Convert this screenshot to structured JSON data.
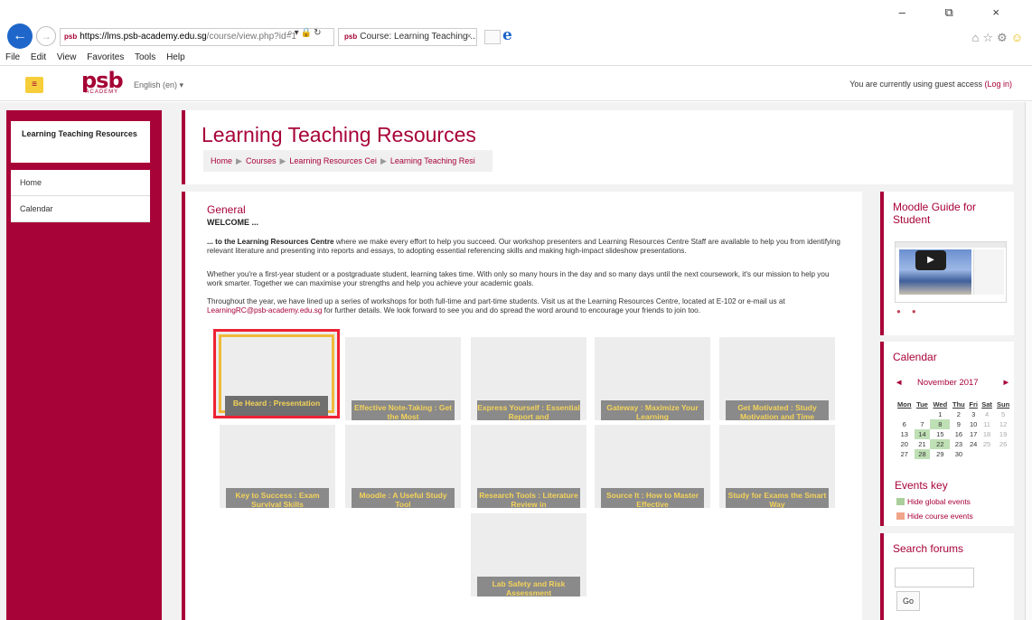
{
  "browser": {
    "url_host": "https://lms.psb-academy.edu.sg",
    "url_path": "/course/view.php?id=1",
    "tab_label": "Course: Learning Teaching ...",
    "menu": [
      "File",
      "Edit",
      "View",
      "Favorites",
      "Tools",
      "Help"
    ],
    "window_controls": "– ⧉ ×",
    "toolbar_icons": [
      "home-icon",
      "star-icon",
      "gear-icon",
      "smiley-icon"
    ]
  },
  "header": {
    "logo": "psb",
    "logo_sub": "ACADEMY",
    "language": "English (en) ▾",
    "guest_text": "You are currently using guest access",
    "login_link": "(Log in)"
  },
  "sidebar": {
    "block_title": "Learning Teaching Resources",
    "nav": [
      "Home",
      "Calendar"
    ]
  },
  "title_panel": {
    "title": "Learning Teaching Resources",
    "breadcrumb": [
      "Home",
      "Courses",
      "Learning Resources Cei",
      "Learning Teaching Resi"
    ]
  },
  "content": {
    "section": "General",
    "welcome": "WELCOME ...",
    "p1_bold": "... to the Learning Resources Centre",
    "p1_text": " where we make every effort to help you succeed. Our workshop presenters and Learning Resources Centre Staff are available to help you from identifying relevant literature and presenting into reports and essays, to adopting essential referencing skills and making high-impact slideshow presentations.",
    "p2": "Whether you're a first-year student or a postgraduate student, learning takes time. With only so many hours in the day and so many days until the next coursework, it's our mission to help you work smarter. Together we can maximise your strengths and help you achieve your academic goals.",
    "p3_a": "Throughout the year, we have lined up a series of workshops for both full-time and part-time students. Visit us at the Learning Resources Centre, located at E-102 or e-mail us at ",
    "p3_email": "LearningRC@psb-academy.edu.sg",
    "p3_b": "  for further details.  We look forward to see you and do spread the word around to encourage your friends to join too.",
    "tiles": [
      "Be Heard : Presentation",
      "Effective Note-Taking : Get the Most",
      "Express Yourself : Essential Report and",
      "Gateway : Maximize Your Learning",
      "Get Motivated : Study Motivation and Time",
      "Key to Success : Exam Survival Skills",
      "Moodle : A Useful Study Tool",
      "Research Tools : Literature Review in",
      "Source It : How to Master Effective",
      "Study for Exams the Smart Way",
      "Lab Safety and Risk Assessment"
    ]
  },
  "moodle_guide": {
    "title": "Moodle Guide for Student"
  },
  "calendar": {
    "title": "Calendar",
    "prev": "◄",
    "month": "November 2017",
    "next": "►",
    "days": [
      "Mon",
      "Tue",
      "Wed",
      "Thu",
      "Fri",
      "Sat",
      "Sun"
    ],
    "weeks": [
      [
        "",
        "",
        "1",
        "2",
        "3",
        "4",
        "5"
      ],
      [
        "6",
        "7",
        "8",
        "9",
        "10",
        "11",
        "12"
      ],
      [
        "13",
        "14",
        "15",
        "16",
        "17",
        "18",
        "19"
      ],
      [
        "20",
        "21",
        "22",
        "23",
        "24",
        "25",
        "26"
      ],
      [
        "27",
        "28",
        "29",
        "30",
        "",
        "",
        ""
      ]
    ],
    "highlighted": [
      "8",
      "14",
      "22",
      "28"
    ],
    "events_key": "Events key",
    "hide_global": "Hide global events",
    "hide_course": "Hide course events"
  },
  "search": {
    "title": "Search forums",
    "go": "Go"
  }
}
